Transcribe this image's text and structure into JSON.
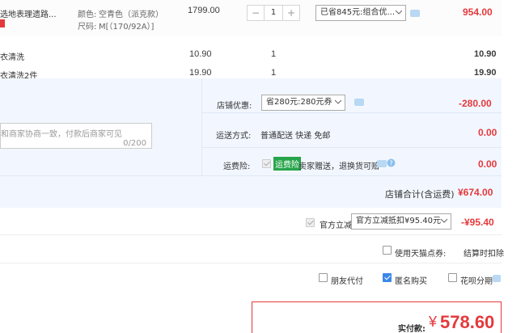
{
  "product": {
    "name": "选地表理遗路...",
    "color_label": "颜色:",
    "color_value": "空青色（派克款）",
    "size_label": "尺码:",
    "size_value": "M[（170/92A）]",
    "unit_price": "1799.00",
    "quantity": "1",
    "qty_minus": "−",
    "qty_plus": "+",
    "discount_select": "已省845元:组合优...",
    "subtotal": "954.00"
  },
  "addons": [
    {
      "name": "衣清洗",
      "price": "10.90",
      "qty": "1",
      "subtotal": "10.90"
    },
    {
      "name": "衣清洗2件",
      "price": "19.90",
      "qty": "1",
      "subtotal": "19.90"
    }
  ],
  "shop": {
    "promo_label": "店铺优惠:",
    "promo_select": "省280元:280元券",
    "promo_amount": "-280.00",
    "memo_placeholder": "和商家协商一致，付款后商家可见",
    "memo_count": "0/200",
    "shipping_label": "运送方式:",
    "shipping_value": "普通配送 快递 免邮",
    "shipping_amount": "0.00",
    "insurance_label": "运费险:",
    "insurance_tag": "运费险",
    "insurance_desc": "卖家赠送，退换货可赔",
    "insurance_amount": "0.00",
    "total_label": "店铺合计(含运费)",
    "total_value": "¥674.00"
  },
  "official": {
    "label": "官方立减",
    "select": "官方立减抵扣¥95.40元",
    "amount": "-¥95.40"
  },
  "points": {
    "label": "使用天猫点券:",
    "note": "结算时扣除"
  },
  "options": {
    "friend_pay": "朋友代付",
    "anonymous": "匿名购买",
    "huabei": "花呗分期"
  },
  "payment": {
    "label": "实付款:",
    "currency": "¥",
    "amount": "578.60"
  },
  "colors": {
    "accent_red": "#e4393c",
    "shop_bg": "#f2f7ff",
    "checkbox_blue": "#3a88e8",
    "insurance_green": "#27a54a"
  }
}
